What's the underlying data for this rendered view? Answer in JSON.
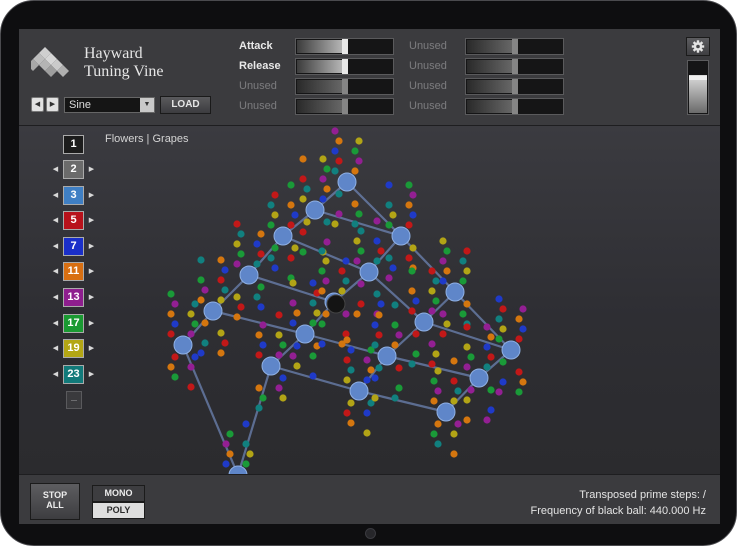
{
  "app": {
    "title_line1": "Hayward",
    "title_line2": "Tuning Vine"
  },
  "waveform": {
    "prev_icon": "triangle-left-icon",
    "next_icon": "triangle-right-icon",
    "selected": "Sine",
    "load_label": "LOAD"
  },
  "params": [
    {
      "label": "Attack",
      "value": 0.5,
      "active": true
    },
    {
      "label": "Release",
      "value": 0.5,
      "active": true
    },
    {
      "label": "Unused",
      "value": 0.5,
      "active": false
    },
    {
      "label": "Unused",
      "value": 0.5,
      "active": false
    },
    {
      "label": "Unused",
      "value": 0.5,
      "active": false
    },
    {
      "label": "Unused",
      "value": 0.5,
      "active": false
    },
    {
      "label": "Unused",
      "value": 0.5,
      "active": false
    },
    {
      "label": "Unused",
      "value": 0.5,
      "active": false
    }
  ],
  "volume": {
    "value": 0.72
  },
  "scale_name": "Flowers | Grapes",
  "primes": [
    {
      "label": "1",
      "color": "#1c1c1c"
    },
    {
      "label": "2",
      "color": "#6b6b6b"
    },
    {
      "label": "3",
      "color": "#3f7fc4"
    },
    {
      "label": "5",
      "color": "#b8121b"
    },
    {
      "label": "7",
      "color": "#1a2fc9"
    },
    {
      "label": "11",
      "color": "#d86f12"
    },
    {
      "label": "13",
      "color": "#8e1e8e"
    },
    {
      "label": "17",
      "color": "#1a9a32"
    },
    {
      "label": "19",
      "color": "#b3a614"
    },
    {
      "label": "23",
      "color": "#127a7a"
    }
  ],
  "controls": {
    "stop_line1": "STOP",
    "stop_line2": "ALL",
    "mono_label": "MONO",
    "poly_label": "POLY"
  },
  "status": {
    "prime_steps": "Transposed prime steps: /",
    "frequency": "Frequency of black ball: 440.000 Hz"
  }
}
